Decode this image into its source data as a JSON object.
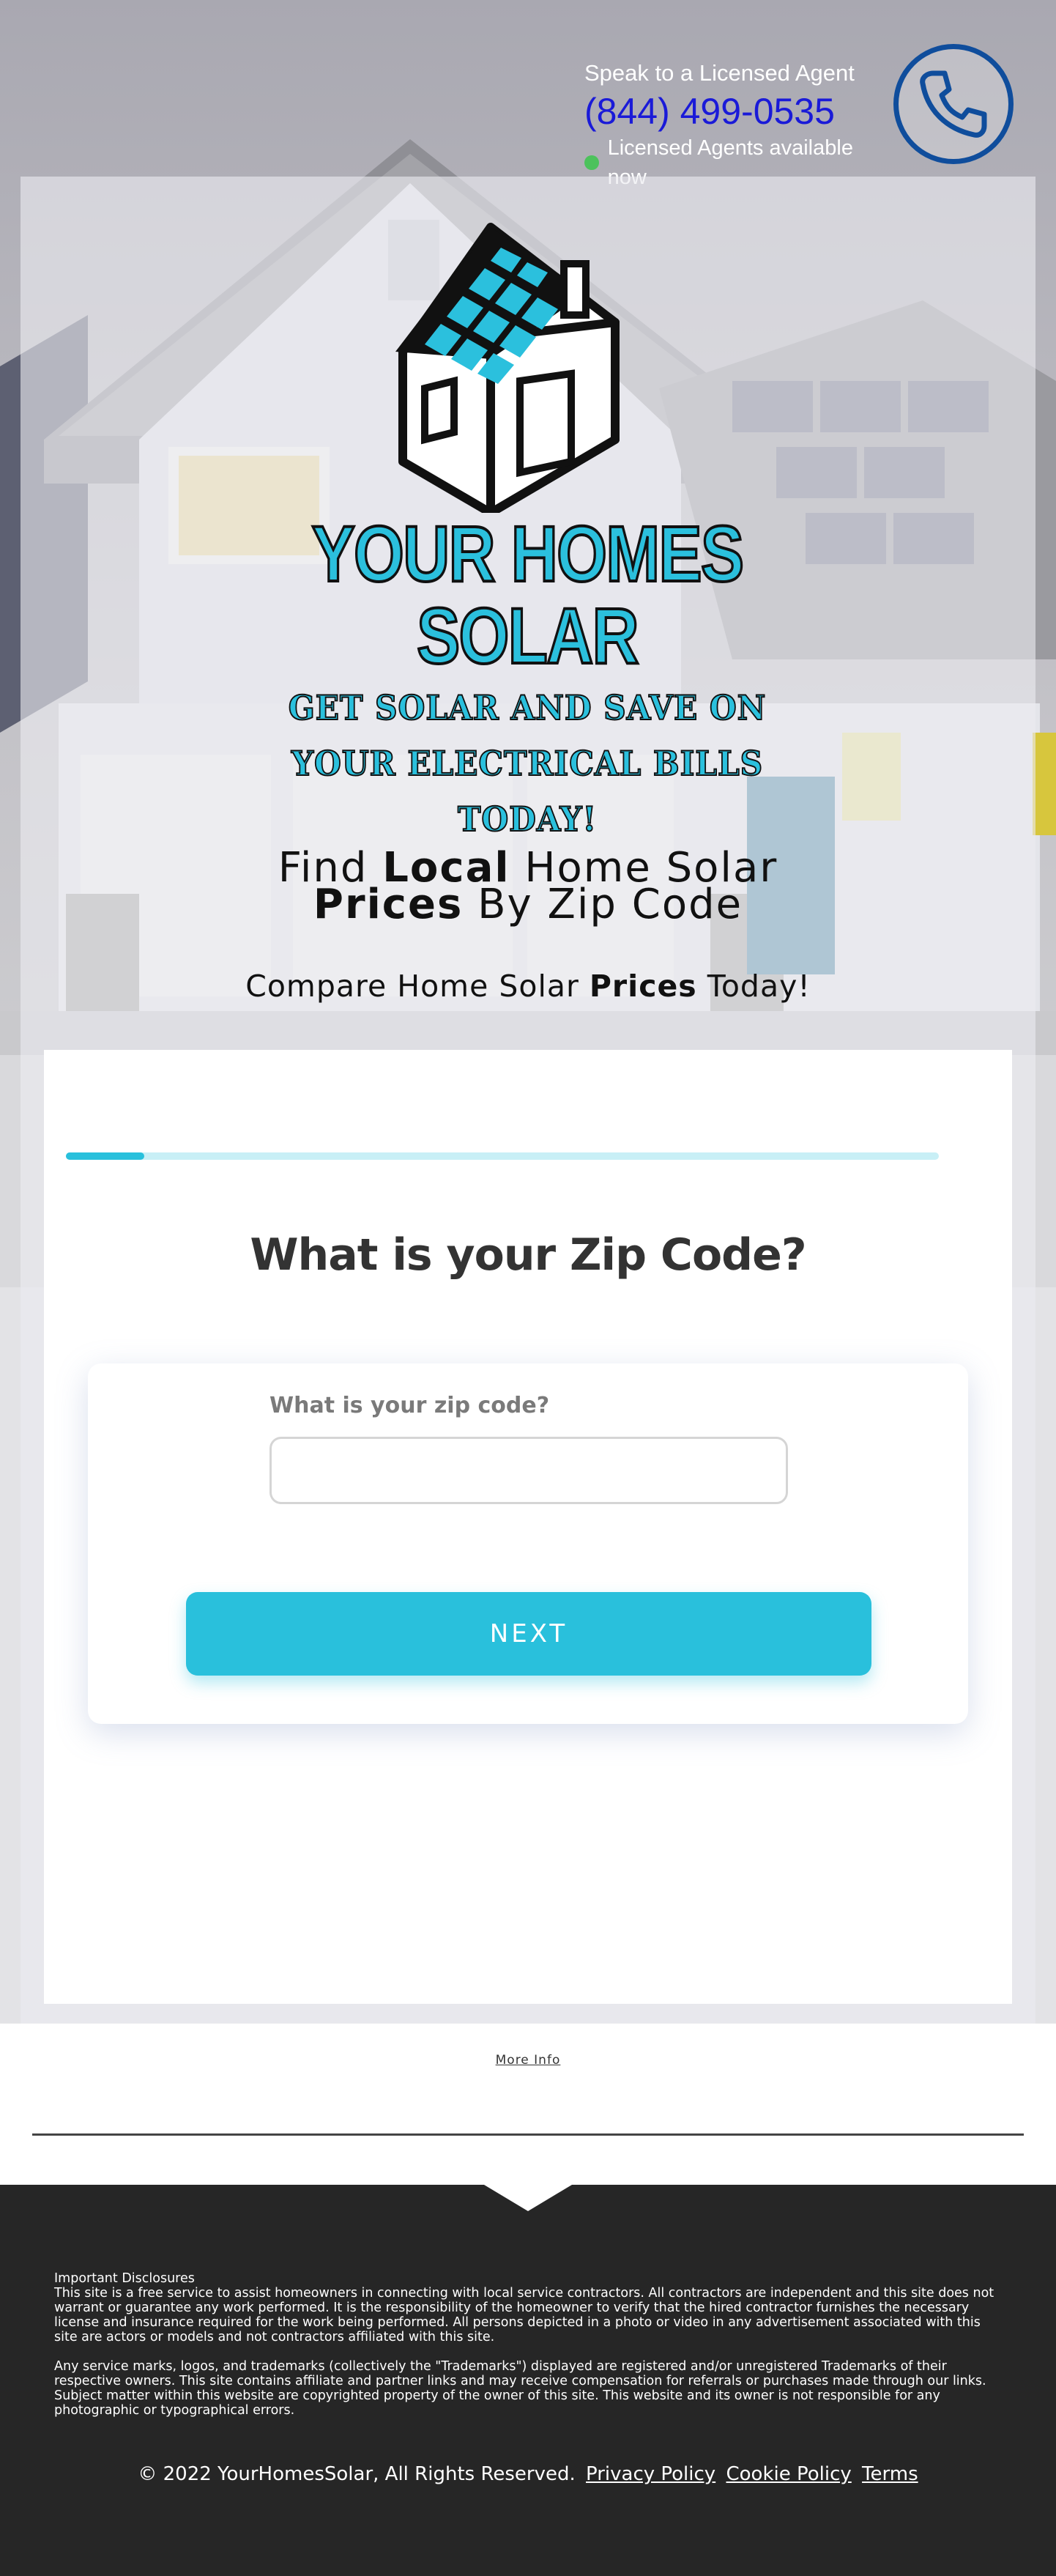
{
  "header": {
    "agent_title": "Speak to a Licensed Agent",
    "phone": "(844) 499-0535",
    "status": "Licensed Agents available now",
    "status_color": "#4cc25c",
    "phone_icon": "phone-icon"
  },
  "logo": {
    "name": "YOUR HOMES SOLAR",
    "tagline_line1": "GET SOLAR AND SAVE ON",
    "tagline_line2": "YOUR ELECTRICAL BILLS",
    "tagline_line3": "TODAY!",
    "icon": "solar-house-icon"
  },
  "hero": {
    "headline_find": "Find",
    "headline_local": "Local",
    "headline_home_solar": "Home Solar",
    "headline_prices": "Prices",
    "headline_by_zip": "By Zip Code",
    "sub_compare": "Compare Home Solar",
    "sub_prices": "Prices",
    "sub_today": "Today!"
  },
  "form": {
    "progress": 0.09,
    "question": "What is your Zip Code?",
    "zip_label": "What is your zip code?",
    "zip_value": "",
    "next_label": "NEXT"
  },
  "links": {
    "more_info": "More Info"
  },
  "footer": {
    "disclosure_title": "Important Disclosures",
    "disclosure_1": "This site is a free service to assist homeowners in connecting with local service contractors. All contractors are independent and this site does not warrant or guarantee any work performed. It is the responsibility of the homeowner to verify that the hired contractor furnishes the necessary license and insurance required for the work being performed. All persons depicted in a photo or video in any advertisement associated with this site are actors or models and not contractors affiliated with this site.",
    "disclosure_2": "Any service marks, logos, and trademarks (collectively the \"Trademarks\") displayed are registered and/or unregistered Trademarks of their respective owners.  This site contains affiliate and partner links and may receive compensation for referrals or purchases made through our links. Subject matter within this website are copyrighted property of the owner of this site.  This website and its owner is not responsible for any photographic or typographical errors.",
    "copyright": "© 2022 YourHomesSolar, All Rights Reserved.",
    "privacy": "Privacy Policy",
    "cookie": "Cookie Policy",
    "terms": "Terms"
  },
  "colors": {
    "accent": "#29c0dc",
    "phone_text": "#1a1ad8",
    "badge_blue": "#0f4d9c",
    "footer_bg": "#262626"
  }
}
